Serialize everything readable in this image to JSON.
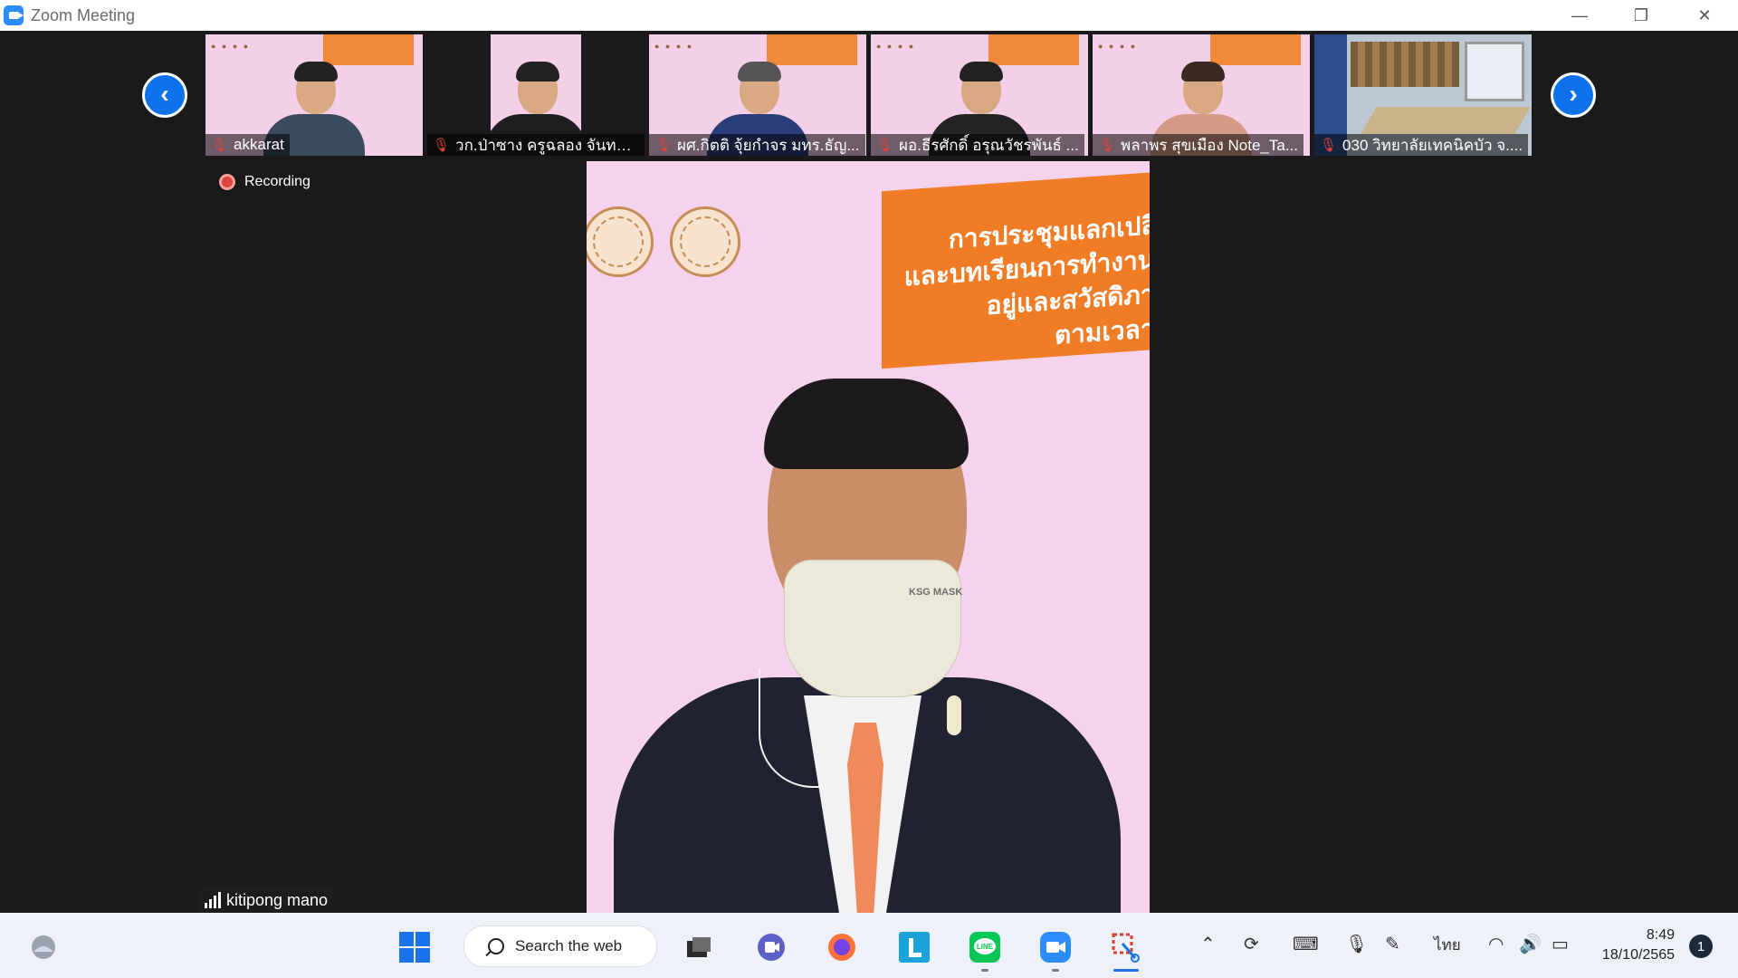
{
  "window": {
    "title": "Zoom Meeting"
  },
  "recording": {
    "label": "Recording"
  },
  "participants": [
    {
      "name": "akkarat"
    },
    {
      "name": "วก.ป่าซาง ครูฉลอง จันทร์คง"
    },
    {
      "name": "ผศ.กิตติ จุ้ยกำจร มทร.ธัญ..."
    },
    {
      "name": "ผอ.ธีรศักดิ์ อรุณวัชรพันธ์ ..."
    },
    {
      "name": "พลาพร สุขเมือง Note_Ta..."
    },
    {
      "name": "030 วิทยาลัยเทคนิคบัว จ...."
    }
  ],
  "active_speaker": {
    "name": "kitipong mano",
    "banner_lines": [
      "การประชุมแลกเปลี่ย",
      "และบทเรียนการทำงานด้",
      "อยู่และสวัสดิภาพ",
      "ตามเวลาที่"
    ],
    "mask_label": "KSG MASK"
  },
  "taskbar": {
    "search_placeholder": "Search the web",
    "language": "ไทย",
    "time": "8:49",
    "date": "18/10/2565",
    "notification_count": "1"
  },
  "colors": {
    "accent": "#0e72ed",
    "banner_orange": "#f07c25",
    "backdrop_pink": "#f5d3ec",
    "muted_red": "#e0443e"
  }
}
